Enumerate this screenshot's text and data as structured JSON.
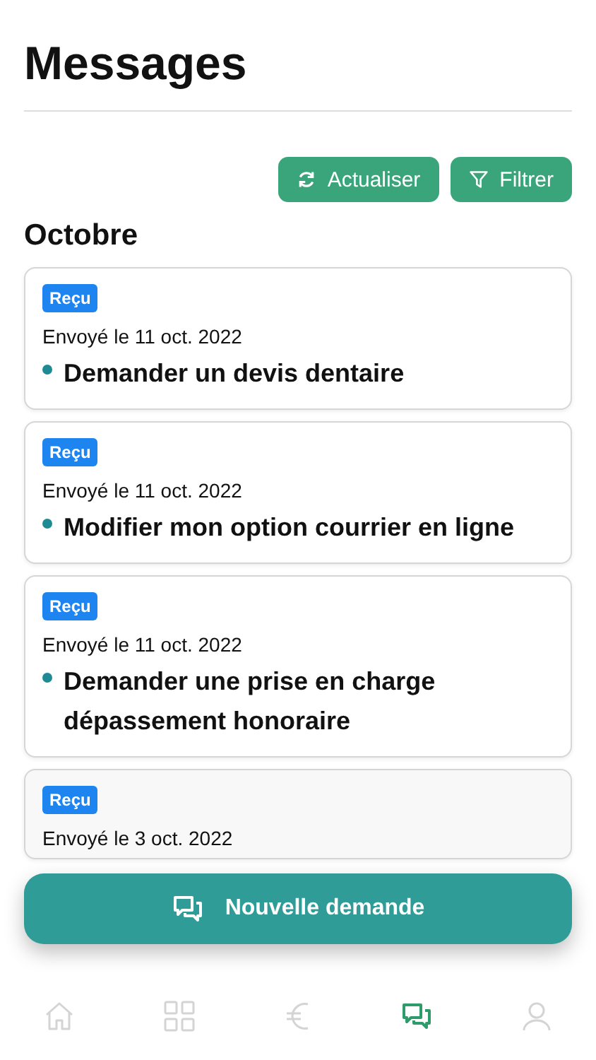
{
  "title": "Messages",
  "actions": [
    {
      "kind": "refresh",
      "label": "Actualiser"
    },
    {
      "kind": "filter",
      "label": "Filtrer"
    }
  ],
  "sections": [
    {
      "heading": "Octobre",
      "messages": [
        {
          "status": "Reçu",
          "sent": "Envoyé le 11 oct. 2022",
          "subject": "Demander un devis dentaire",
          "unread": true
        },
        {
          "status": "Reçu",
          "sent": "Envoyé le 11 oct. 2022",
          "subject": "Modifier mon option courrier en ligne",
          "unread": true
        },
        {
          "status": "Reçu",
          "sent": "Envoyé le 11 oct. 2022",
          "subject": "Demander une prise en charge dépassement honoraire",
          "unread": true
        },
        {
          "status": "Reçu",
          "sent": "Envoyé le 3 oct. 2022",
          "unread": false
        }
      ]
    }
  ],
  "new_request": {
    "label": "Nouvelle demande"
  },
  "nav": [
    {
      "kind": "home",
      "selected": false
    },
    {
      "kind": "grid",
      "selected": false
    },
    {
      "kind": "euro",
      "selected": false
    },
    {
      "kind": "chat",
      "selected": true
    },
    {
      "kind": "person",
      "selected": false
    }
  ]
}
